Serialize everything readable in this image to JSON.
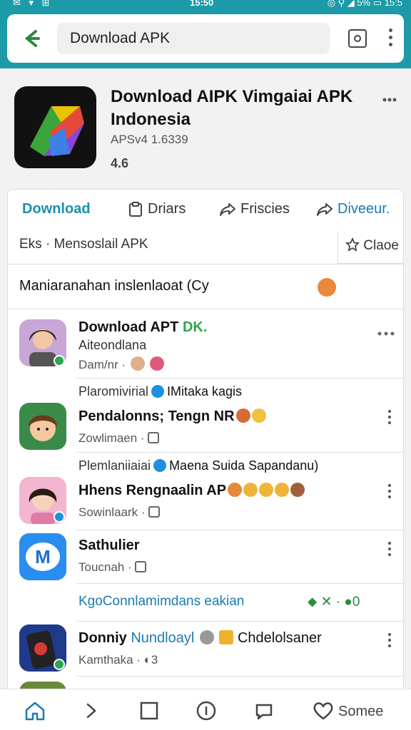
{
  "status_bar": {
    "time": "15:50",
    "left_icons": "✉ ▾ ⊞",
    "right_icons": "◎ ⚲ ◢ 5% ▭ 15:5"
  },
  "search": {
    "query": "Download APK"
  },
  "app": {
    "title": "Download AIPK Vimgaiai APK Indonesia",
    "version": "APSv4 1.6339",
    "rating": "4.6"
  },
  "tabs": [
    {
      "label": "Download"
    },
    {
      "label": "Driars"
    },
    {
      "label": "Friscies"
    },
    {
      "label": "Diveeur."
    }
  ],
  "subheader": {
    "left": "Eks · Mensoslail APK",
    "right": "Claoe"
  },
  "banner": {
    "text": "Maniaranahan inslenlaoat (Cy"
  },
  "rows": [
    {
      "pre": "",
      "title": "Download APT",
      "title_tag": "DK.",
      "line2": "Aiteondlana",
      "meta": "Dam/nr ·"
    },
    {
      "pre": "Plaromivirial",
      "pre_tail": "IMitaka kagis",
      "title": "Pendalonns; Tengn NR",
      "meta": "Zowlimaen ·"
    },
    {
      "pre": "Plemlaniiaiai",
      "pre_tail": "Maena Suida Sapandanu)",
      "title": "Hhens Rengnaalin AP",
      "meta": "Sowinlaark ·"
    },
    {
      "pre": "",
      "title": "Sathulier",
      "meta": "Toucnah ·"
    },
    {
      "pre": "",
      "title": "Donniy",
      "title_link": "Nundloayl",
      "title_tail": "Chdelolsaner",
      "meta": "Kamthaka · ◐3"
    }
  ],
  "promo_link": "KgoConnlamimdans eakian",
  "promo_icons": "⬥  ✕ · ●0",
  "bottom_nav": {
    "label": "Somee"
  },
  "colors": {
    "accent": "#1d9aa8",
    "link": "#1a7bb0",
    "verified": "#1d8fe0",
    "green": "#2ea44f"
  }
}
